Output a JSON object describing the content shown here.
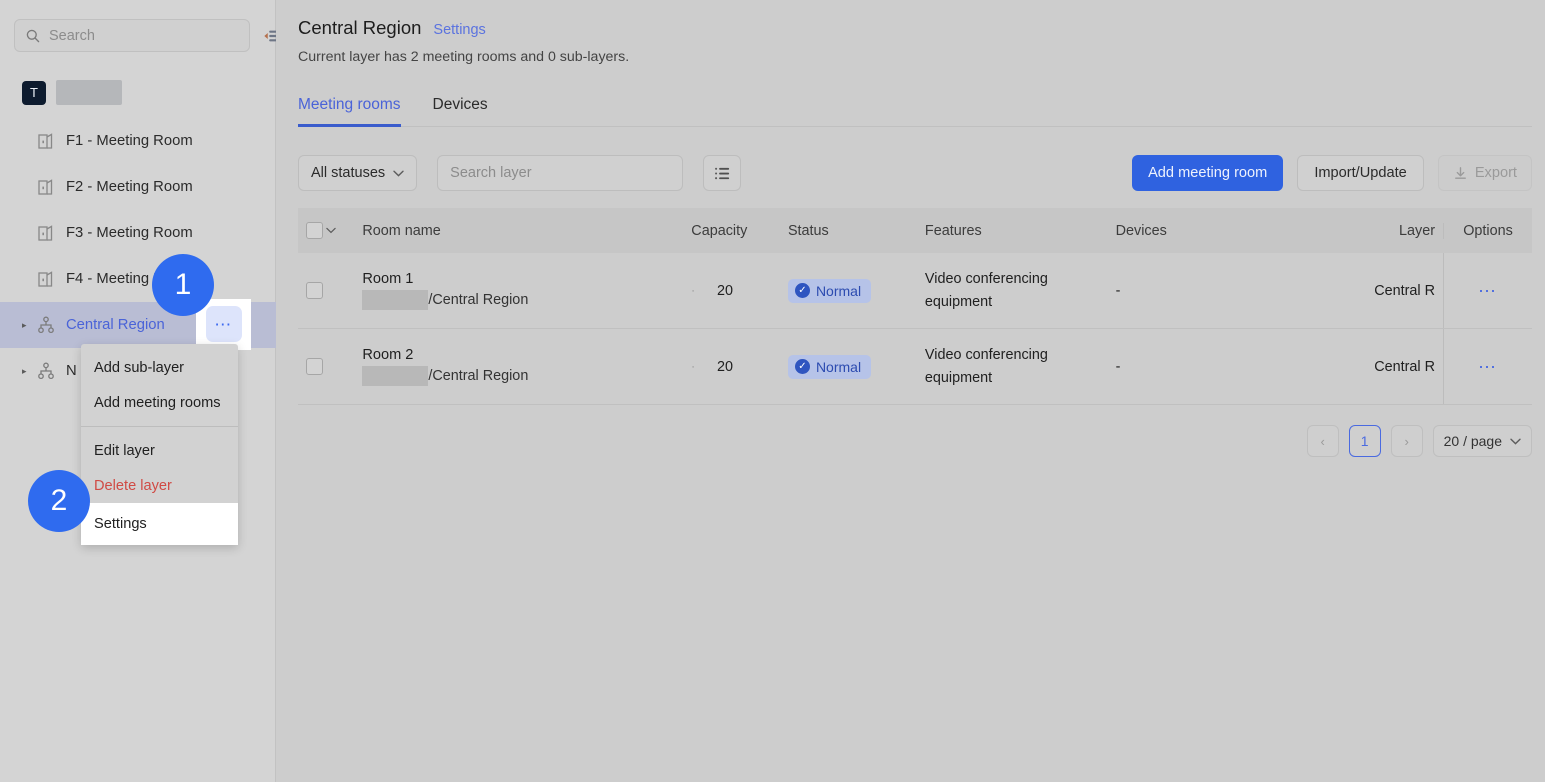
{
  "sidebar": {
    "search": {
      "placeholder": "Search",
      "icon": "search-icon"
    },
    "collapse_icon": "collapse-sidebar-icon",
    "org": {
      "logo_letter": "T",
      "name_redacted": ""
    },
    "tree": [
      {
        "label": "F1 - Meeting Room",
        "type": "room",
        "icon": "building-icon"
      },
      {
        "label": "F2 - Meeting Room",
        "type": "room",
        "icon": "building-icon"
      },
      {
        "label": "F3 - Meeting Room",
        "type": "room",
        "icon": "building-icon"
      },
      {
        "label": "F4 - Meeting Room",
        "type": "room",
        "icon": "building-icon"
      },
      {
        "label": "Central Region",
        "type": "layer",
        "icon": "hierarchy-icon",
        "selected": true,
        "caret": "▸"
      },
      {
        "label": "N",
        "type": "layer",
        "icon": "hierarchy-icon",
        "selected": false,
        "caret": "▸"
      }
    ],
    "row_menu_icon": "ellipsis-icon"
  },
  "context_menu": {
    "items": [
      {
        "label": "Add sub-layer"
      },
      {
        "label": "Add meeting rooms"
      },
      {
        "label": "Edit layer"
      },
      {
        "label": "Delete layer"
      },
      {
        "label": "Settings"
      }
    ]
  },
  "steps": {
    "one": "1",
    "two": "2"
  },
  "main": {
    "title": "Central Region",
    "title_link": "Settings",
    "subtitle": "Current layer has 2 meeting rooms and 0 sub-layers.",
    "tabs": [
      {
        "label": "Meeting rooms",
        "active": true
      },
      {
        "label": "Devices",
        "active": false
      }
    ],
    "toolbar": {
      "status_filter": "All statuses",
      "search_placeholder": "Search layer",
      "columns_icon": "list-settings-icon",
      "add_button": "Add meeting room",
      "import_button": "Import/Update",
      "export_button": "Export",
      "export_icon": "download-icon",
      "export_disabled": true
    },
    "table": {
      "columns": [
        "Room name",
        "Capacity",
        "Status",
        "Features",
        "Devices",
        "Layer",
        "Options"
      ],
      "rows": [
        {
          "name": "Room 1",
          "path_redacted": "",
          "path_suffix": "/Central Region",
          "sort_dot": "·",
          "capacity": "20",
          "status": "Normal",
          "status_icon": "check-circle-icon",
          "features": "Video conferencing equipment",
          "devices": "-",
          "layer": "Central R",
          "options_icon": "ellipsis-icon"
        },
        {
          "name": "Room 2",
          "path_redacted": "",
          "path_suffix": "/Central Region",
          "sort_dot": "·",
          "capacity": "20",
          "status": "Normal",
          "status_icon": "check-circle-icon",
          "features": "Video conferencing equipment",
          "devices": "-",
          "layer": "Central R",
          "options_icon": "ellipsis-icon"
        }
      ]
    },
    "pagination": {
      "prev": "‹",
      "current_page": "1",
      "next": "›",
      "page_size": "20 / page"
    }
  },
  "colors": {
    "accent": "#2f62e0",
    "link": "#4a63d8",
    "danger": "#d04a44",
    "badge_bg": "#b6c3e8",
    "badge_text": "#2c4bb0",
    "step_badge": "#2f6bef"
  }
}
